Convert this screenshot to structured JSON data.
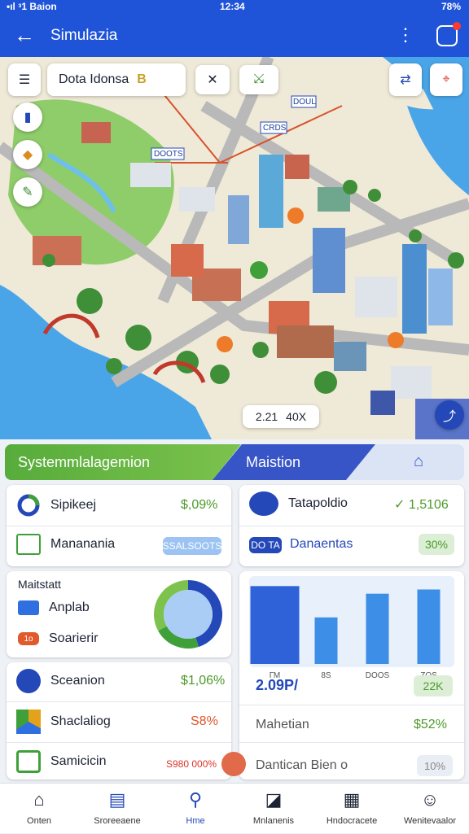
{
  "status_bar": {
    "carrier": "•ıl ᵌ1 Baion",
    "time": "12:34",
    "battery": "78%"
  },
  "header": {
    "title": "Simulazia",
    "back_icon": "arrow-left-icon",
    "menu_icon": "more-vertical-icon",
    "alert_icon": "notification-icon"
  },
  "map": {
    "search_text": "Dota Idonsa",
    "search_badge": "B",
    "tool_close": "✕",
    "tool_split": "⤩",
    "district_labels": [
      "DOUL",
      "CRDS",
      "DOOTS"
    ],
    "zoom_readout": "2.21",
    "zoom_secondary": "40X"
  },
  "banner": {
    "left_label": "Systemmlalagemion",
    "right_label": "Maistion"
  },
  "left_cards": [
    {
      "label": "Sipikeej",
      "value": "$,09%"
    },
    {
      "label": "Mananania",
      "badge": "SSALSOOTS"
    }
  ],
  "right_cards": [
    {
      "label": "Tatapoldio",
      "value": "1,5106"
    },
    {
      "badge": "DO TA",
      "label": "Danaentas",
      "pill": "30%"
    }
  ],
  "donut_card": {
    "title": "Maitstatt",
    "items": [
      {
        "label": "Anplab"
      },
      {
        "badge": "1o",
        "label": "Soarierir"
      }
    ],
    "segments": [
      0.45,
      0.22,
      0.33
    ]
  },
  "bar_chart": {
    "categories": [
      "ГМ",
      "8S",
      "DOOS",
      "ZOS"
    ],
    "values": [
      92,
      55,
      83,
      88
    ],
    "readout": "2.09Р/ ",
    "readout_pill": "22K"
  },
  "list_left": [
    {
      "label": "Sceanion",
      "value": "$1,06%"
    },
    {
      "label": "Shaclaliog",
      "value": "S8%"
    },
    {
      "label": "Samicicin",
      "value": "S980 000%"
    }
  ],
  "list_right": [
    {
      "label": "Mahetian",
      "value": "$52%"
    },
    {
      "label": "Dantican Bien o",
      "pill": "10%"
    }
  ],
  "colors": {
    "primary": "#1f54d8",
    "green": "#4c9a2a",
    "red": "#d9362b",
    "water": "#4aa5e8"
  },
  "nav": [
    {
      "label": "Onten",
      "icon": "home-icon"
    },
    {
      "label": "Sroreeaene",
      "icon": "document-icon"
    },
    {
      "label": "Hme",
      "icon": "map-pin-icon",
      "active": true
    },
    {
      "label": "Mnlanenis",
      "icon": "chart-icon"
    },
    {
      "label": "Hndocracete",
      "icon": "clipboard-icon"
    },
    {
      "label": "Wenitevaalor",
      "icon": "user-icon"
    }
  ]
}
